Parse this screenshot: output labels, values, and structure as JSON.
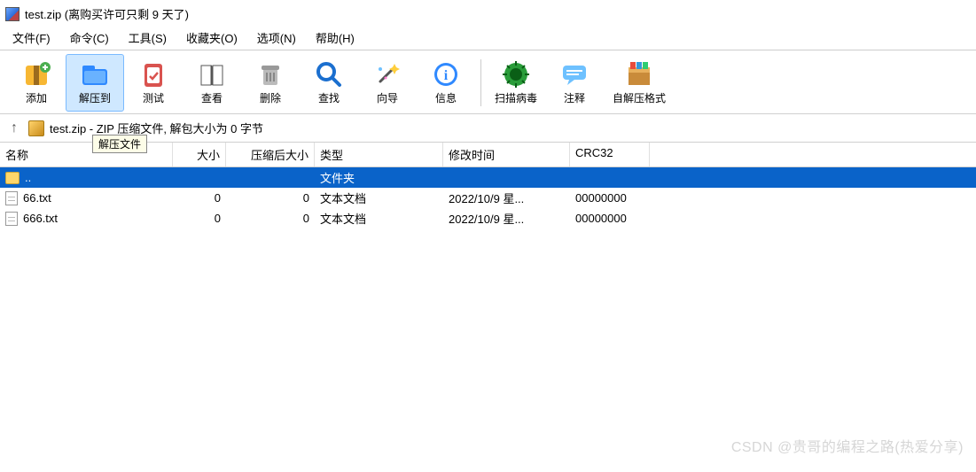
{
  "window": {
    "title": "test.zip (离购买许可只剩 9 天了)"
  },
  "menu": {
    "file": "文件(F)",
    "cmd": "命令(C)",
    "tool": "工具(S)",
    "fav": "收藏夹(O)",
    "opt": "选项(N)",
    "help": "帮助(H)"
  },
  "toolbar": {
    "add": "添加",
    "extract": "解压到",
    "test": "测试",
    "view": "查看",
    "delete": "删除",
    "find": "查找",
    "wizard": "向导",
    "info": "信息",
    "scan": "扫描病毒",
    "comment": "注释",
    "sfx": "自解压格式"
  },
  "tooltip": "解压文件",
  "pathbar": {
    "text": "test.zip - ZIP 压缩文件, 解包大小为 0 字节"
  },
  "columns": {
    "name": "名称",
    "size": "大小",
    "packed": "压缩后大小",
    "type": "类型",
    "modified": "修改时间",
    "crc": "CRC32"
  },
  "rows": [
    {
      "name": "..",
      "type": "文件夹",
      "size": "",
      "packed": "",
      "modified": "",
      "crc": "",
      "folder": true
    },
    {
      "name": "66.txt",
      "type": "文本文档",
      "size": "0",
      "packed": "0",
      "modified": "2022/10/9 星...",
      "crc": "00000000",
      "folder": false
    },
    {
      "name": "666.txt",
      "type": "文本文档",
      "size": "0",
      "packed": "0",
      "modified": "2022/10/9 星...",
      "crc": "00000000",
      "folder": false
    }
  ],
  "watermark": "CSDN @贵哥的编程之路(热爱分享)"
}
